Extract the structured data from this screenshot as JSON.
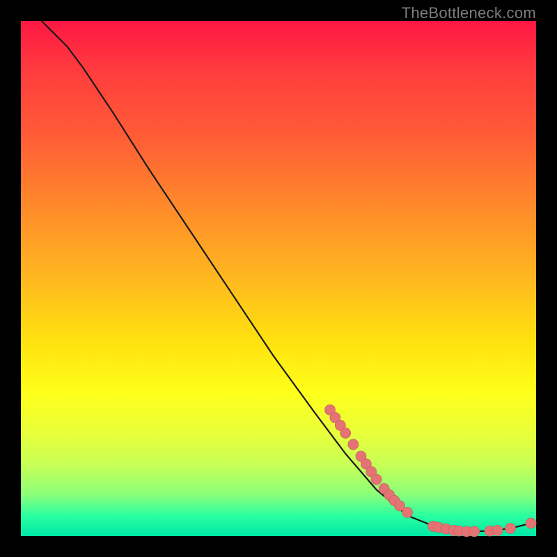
{
  "attribution": "TheBottleneck.com",
  "chart_data": {
    "type": "line",
    "title": "",
    "xlabel": "",
    "ylabel": "",
    "xlim": [
      0,
      100
    ],
    "ylim": [
      0,
      100
    ],
    "grid": false,
    "legend": false,
    "description": "Bottleneck-style curve on red→yellow→green vertical gradient background. Black curve descends from top-left, nearly linearly, flattens near bottom-right. Coral dots mark samples on the lower/right segment of the curve.",
    "curve_points": [
      {
        "x": 4,
        "y": 100
      },
      {
        "x": 6,
        "y": 98
      },
      {
        "x": 9,
        "y": 95
      },
      {
        "x": 12,
        "y": 91
      },
      {
        "x": 18,
        "y": 82
      },
      {
        "x": 25,
        "y": 71
      },
      {
        "x": 33,
        "y": 59
      },
      {
        "x": 41,
        "y": 47
      },
      {
        "x": 49,
        "y": 35
      },
      {
        "x": 57,
        "y": 24
      },
      {
        "x": 63,
        "y": 16
      },
      {
        "x": 69,
        "y": 9
      },
      {
        "x": 75,
        "y": 4
      },
      {
        "x": 81,
        "y": 1.6
      },
      {
        "x": 86,
        "y": 0.9
      },
      {
        "x": 91,
        "y": 1.0
      },
      {
        "x": 95,
        "y": 1.5
      },
      {
        "x": 99,
        "y": 2.5
      }
    ],
    "dots": [
      {
        "x": 60,
        "y": 24.5
      },
      {
        "x": 61,
        "y": 23
      },
      {
        "x": 62,
        "y": 21.5
      },
      {
        "x": 63,
        "y": 20
      },
      {
        "x": 64.5,
        "y": 17.8
      },
      {
        "x": 66,
        "y": 15.5
      },
      {
        "x": 67,
        "y": 14
      },
      {
        "x": 68,
        "y": 12.5
      },
      {
        "x": 69,
        "y": 11
      },
      {
        "x": 70.5,
        "y": 9.2
      },
      {
        "x": 71.5,
        "y": 8
      },
      {
        "x": 72.5,
        "y": 6.9
      },
      {
        "x": 73.5,
        "y": 5.9
      },
      {
        "x": 75,
        "y": 4.6
      },
      {
        "x": 80,
        "y": 1.9
      },
      {
        "x": 81,
        "y": 1.7
      },
      {
        "x": 82.5,
        "y": 1.4
      },
      {
        "x": 84,
        "y": 1.1
      },
      {
        "x": 85,
        "y": 1.0
      },
      {
        "x": 86.5,
        "y": 0.9
      },
      {
        "x": 88,
        "y": 0.9
      },
      {
        "x": 91,
        "y": 1.0
      },
      {
        "x": 92.5,
        "y": 1.1
      },
      {
        "x": 95,
        "y": 1.5
      },
      {
        "x": 99,
        "y": 2.5
      }
    ]
  }
}
